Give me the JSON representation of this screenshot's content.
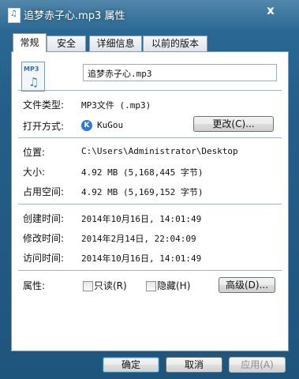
{
  "window": {
    "title": "追梦赤子心.mp3 属性",
    "close_label": "x"
  },
  "tabs": [
    {
      "label": "常规"
    },
    {
      "label": "安全"
    },
    {
      "label": "详细信息"
    },
    {
      "label": "以前的版本"
    }
  ],
  "general": {
    "file_icon_tag": "MP3",
    "file_name": "追梦赤子心.mp3",
    "file_type_label": "文件类型:",
    "file_type_value": "MP3文件 (.mp3)",
    "open_with_label": "打开方式:",
    "open_with_app": "KuGou",
    "change_button": "更改(C)...",
    "location_label": "位置:",
    "location_value": "C:\\Users\\Administrator\\Desktop",
    "size_label": "大小:",
    "size_value": "4.92 MB (5,168,445 字节)",
    "size_on_disk_label": "占用空间:",
    "size_on_disk_value": "4.92 MB (5,169,152 字节)",
    "created_label": "创建时间:",
    "created_value": "2014年10月16日, 14:01:49",
    "modified_label": "修改时间:",
    "modified_value": "2014年2月14日, 22:04:09",
    "accessed_label": "访问时间:",
    "accessed_value": "2014年10月16日, 14:01:49",
    "attributes_label": "属性:",
    "readonly_label": "只读(R)",
    "hidden_label": "隐藏(H)",
    "advanced_button": "高级(D)..."
  },
  "footer": {
    "ok": "确定",
    "cancel": "取消",
    "apply": "应用(A)"
  }
}
